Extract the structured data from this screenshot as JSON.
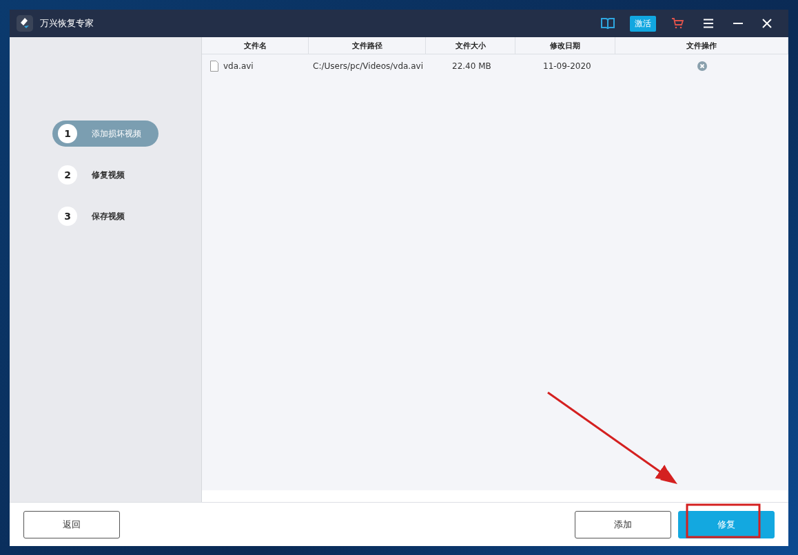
{
  "window": {
    "title": "万兴恢复专家",
    "activate_button": "激活"
  },
  "steps": [
    {
      "number": "1",
      "label": "添加损坏视频",
      "selected": true
    },
    {
      "number": "2",
      "label": "修复视频",
      "selected": false
    },
    {
      "number": "3",
      "label": "保存视频",
      "selected": false
    }
  ],
  "table": {
    "columns": [
      "文件名",
      "文件路径",
      "文件大小",
      "修改日期",
      "文件操作"
    ],
    "rows": [
      {
        "name": "vda.avi",
        "path": "C:/Users/pc/Videos/vda.avi",
        "size": "22.40 MB",
        "date": "11-09-2020"
      }
    ]
  },
  "buttons": {
    "back": "返回",
    "add": "添加",
    "repair": "修复"
  }
}
